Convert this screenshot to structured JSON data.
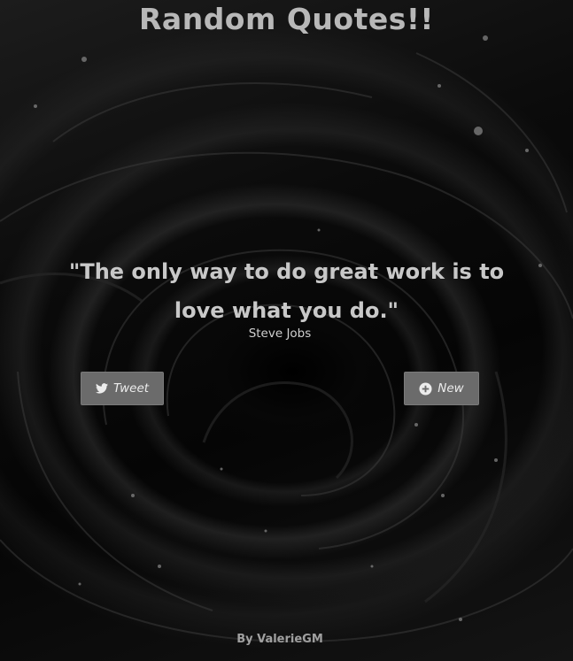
{
  "header": {
    "title": "Random Quotes!!"
  },
  "quote": {
    "text": "\"The only way to do great work is to love what you do.\"",
    "author": "Steve Jobs"
  },
  "actions": {
    "tweet_label": "Tweet",
    "tweet_icon": "twitter-bird-icon",
    "new_label": "New",
    "new_icon": "plus-circle-icon"
  },
  "footer": {
    "credit": "By ValerieGM"
  },
  "colors": {
    "background": "#050505",
    "title": "#b8b8b8",
    "quote_text": "#c8c8c8",
    "button_bg": "#6b6b6b",
    "button_text": "#ececec"
  }
}
